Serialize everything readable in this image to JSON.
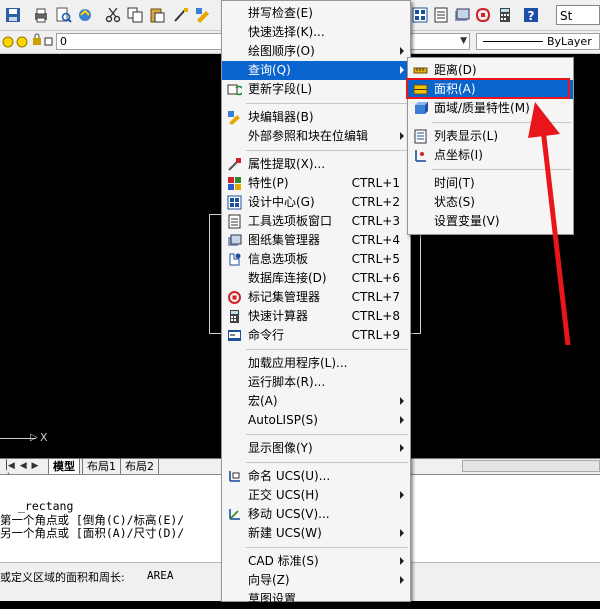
{
  "toolbar": {
    "style_label": "St"
  },
  "layer": {
    "current": "0",
    "linetype": "ByLayer"
  },
  "canvas": {
    "x_axis_label": "X"
  },
  "tabs": [
    "模型",
    "布局1",
    "布局2"
  ],
  "command_lines": [
    "_rectang",
    "第一个角点或 [倒角(C)/标高(E)/",
    "另一个角点或 [面积(A)/尺寸(D)/"
  ],
  "status": {
    "prompt": "或定义区域的面积和周长:",
    "command": "AREA"
  },
  "tools_menu": [
    {
      "label": "拼写检查(E)"
    },
    {
      "label": "快速选择(K)..."
    },
    {
      "label": "绘图顺序(O)",
      "submenu": true
    },
    {
      "label": "查询(Q)",
      "submenu": true,
      "active": true
    },
    {
      "label": "更新字段(L)",
      "icon": "update-field-icon"
    },
    {
      "sep": true
    },
    {
      "label": "块编辑器(B)",
      "icon": "block-editor-icon"
    },
    {
      "label": "外部参照和块在位编辑",
      "submenu": true
    },
    {
      "sep": true
    },
    {
      "label": "属性提取(X)...",
      "icon": "attribute-extract-icon"
    },
    {
      "label": "特性(P)",
      "shortcut": "CTRL+1",
      "icon": "properties-icon"
    },
    {
      "label": "设计中心(G)",
      "shortcut": "CTRL+2",
      "icon": "design-center-icon"
    },
    {
      "label": "工具选项板窗口",
      "shortcut": "CTRL+3",
      "icon": "tool-palettes-icon"
    },
    {
      "label": "图纸集管理器",
      "shortcut": "CTRL+4",
      "icon": "sheet-set-icon"
    },
    {
      "label": "信息选项板",
      "shortcut": "CTRL+5",
      "icon": "info-palette-icon"
    },
    {
      "label": "数据库连接(D)",
      "shortcut": "CTRL+6"
    },
    {
      "label": "标记集管理器",
      "shortcut": "CTRL+7",
      "icon": "markup-icon"
    },
    {
      "label": "快速计算器",
      "shortcut": "CTRL+8",
      "icon": "calculator-icon"
    },
    {
      "label": "命令行",
      "shortcut": "CTRL+9",
      "icon": "command-line-icon"
    },
    {
      "sep": true
    },
    {
      "label": "加载应用程序(L)..."
    },
    {
      "label": "运行脚本(R)..."
    },
    {
      "label": "宏(A)",
      "submenu": true
    },
    {
      "label": "AutoLISP(S)",
      "submenu": true
    },
    {
      "sep": true
    },
    {
      "label": "显示图像(Y)",
      "submenu": true
    },
    {
      "sep": true
    },
    {
      "label": "命名 UCS(U)...",
      "icon": "named-ucs-icon"
    },
    {
      "label": "正交 UCS(H)",
      "submenu": true
    },
    {
      "label": "移动 UCS(V)...",
      "icon": "move-ucs-icon"
    },
    {
      "label": "新建 UCS(W)",
      "submenu": true
    },
    {
      "sep": true
    },
    {
      "label": "CAD 标准(S)",
      "submenu": true
    },
    {
      "label": "向导(Z)",
      "submenu": true
    },
    {
      "label": "草图设置"
    }
  ],
  "inquiry_menu": [
    {
      "label": "距离(D)",
      "icon": "distance-icon"
    },
    {
      "label": "面积(A)",
      "icon": "area-icon",
      "active": true
    },
    {
      "label": "面域/质量特性(M)",
      "icon": "region-mass-icon"
    },
    {
      "sep": true
    },
    {
      "label": "列表显示(L)",
      "icon": "list-icon"
    },
    {
      "label": "点坐标(I)",
      "icon": "id-point-icon"
    },
    {
      "sep": true
    },
    {
      "label": "时间(T)"
    },
    {
      "label": "状态(S)"
    },
    {
      "label": "设置变量(V)"
    }
  ],
  "colors": {
    "highlight": "#0a64ce",
    "annotation": "#e8151b"
  }
}
